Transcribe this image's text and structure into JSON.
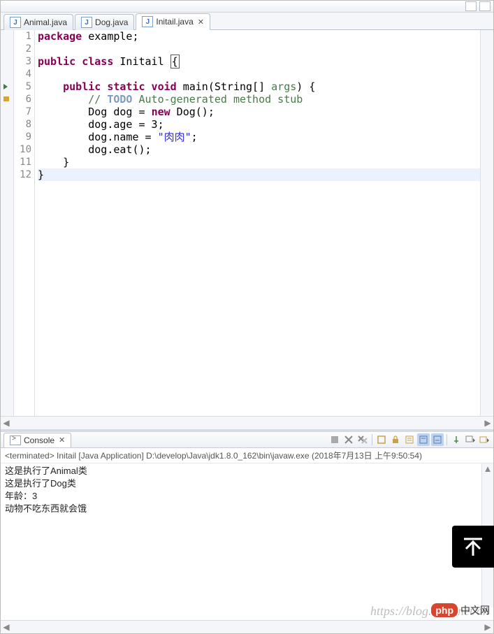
{
  "tabs": [
    {
      "label": "Animal.java"
    },
    {
      "label": "Dog.java"
    },
    {
      "label": "Initail.java"
    }
  ],
  "active_tab": 2,
  "code_lines": [
    {
      "n": "1",
      "segs": [
        {
          "t": "package",
          "c": "kw"
        },
        {
          "t": " example;",
          "c": ""
        }
      ]
    },
    {
      "n": "2",
      "segs": []
    },
    {
      "n": "3",
      "segs": [
        {
          "t": "public class",
          "c": "kw"
        },
        {
          "t": " Initail ",
          "c": ""
        },
        {
          "t": "{",
          "c": "cursor"
        }
      ]
    },
    {
      "n": "4",
      "segs": []
    },
    {
      "n": "5",
      "segs": [
        {
          "t": "    ",
          "c": ""
        },
        {
          "t": "public static void",
          "c": "kw"
        },
        {
          "t": " main(String[] ",
          "c": ""
        },
        {
          "t": "args",
          "c": "cm"
        },
        {
          "t": ") {",
          "c": ""
        }
      ],
      "marker": "play"
    },
    {
      "n": "6",
      "segs": [
        {
          "t": "        ",
          "c": ""
        },
        {
          "t": "// ",
          "c": "cm"
        },
        {
          "t": "TODO",
          "c": "todo"
        },
        {
          "t": " Auto-generated method stub",
          "c": "cm"
        }
      ],
      "marker": "flag"
    },
    {
      "n": "7",
      "segs": [
        {
          "t": "        Dog dog = ",
          "c": ""
        },
        {
          "t": "new",
          "c": "kw"
        },
        {
          "t": " Dog();",
          "c": ""
        }
      ]
    },
    {
      "n": "8",
      "segs": [
        {
          "t": "        dog.age = 3;",
          "c": ""
        }
      ]
    },
    {
      "n": "9",
      "segs": [
        {
          "t": "        dog.name = ",
          "c": ""
        },
        {
          "t": "\"肉肉\"",
          "c": "str"
        },
        {
          "t": ";",
          "c": ""
        }
      ]
    },
    {
      "n": "10",
      "segs": [
        {
          "t": "        dog.eat();",
          "c": ""
        }
      ]
    },
    {
      "n": "11",
      "segs": [
        {
          "t": "    }",
          "c": ""
        }
      ]
    },
    {
      "n": "12",
      "segs": [
        {
          "t": "}",
          "c": ""
        }
      ],
      "hl": true
    }
  ],
  "console": {
    "tab_label": "Console",
    "status": "<terminated> Initail [Java Application] D:\\develop\\Java\\jdk1.8.0_162\\bin\\javaw.exe (2018年7月13日 上午9:50:54)",
    "output": [
      "这是执行了Animal类",
      "这是执行了Dog类",
      "年龄：3",
      "动物不吃东西就会饿"
    ]
  },
  "watermark": "https://blog.csdn.net/an",
  "brand": {
    "logo": "php",
    "text": "中文网"
  }
}
